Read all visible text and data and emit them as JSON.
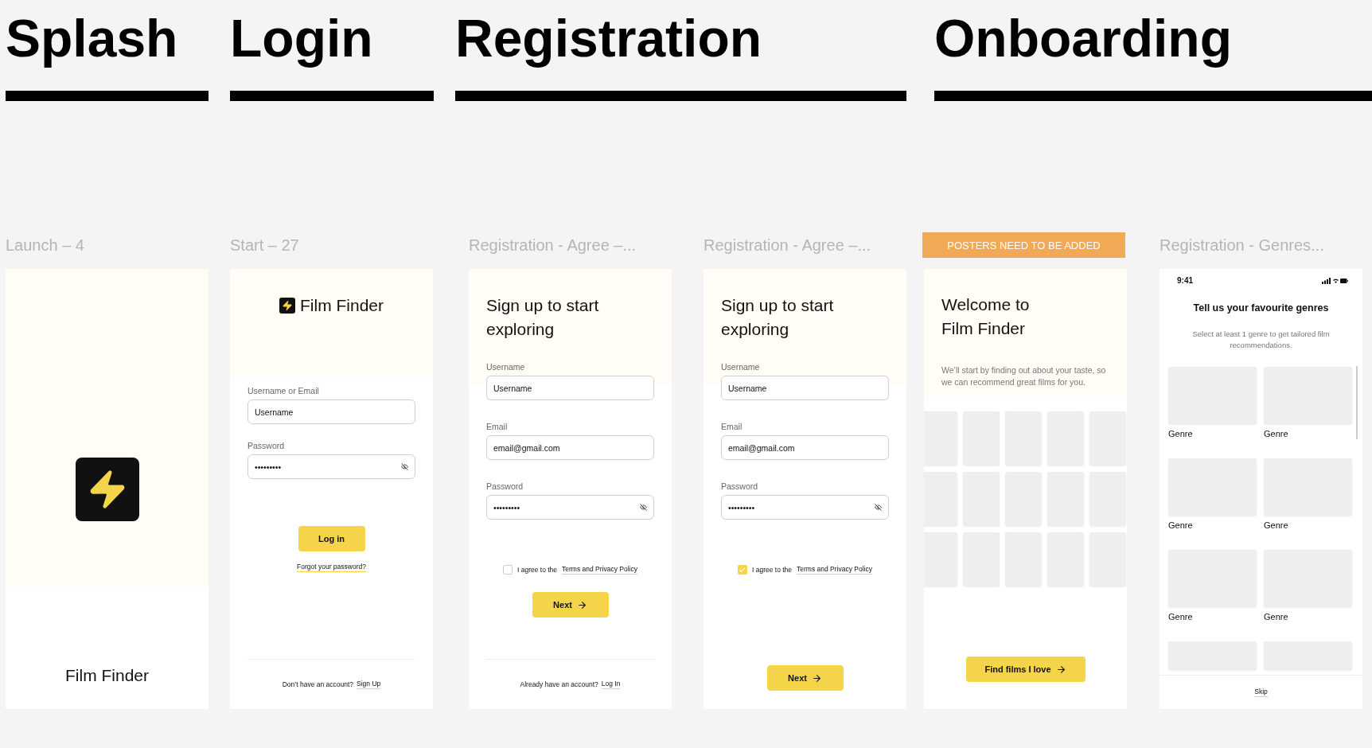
{
  "sections": [
    {
      "title": "Splash"
    },
    {
      "title": "Login"
    },
    {
      "title": "Registration"
    },
    {
      "title": "Onboarding"
    }
  ],
  "frames": [
    {
      "kind": "splash",
      "label": "Launch – 4",
      "app_name": "Film Finder"
    },
    {
      "kind": "login",
      "label": "Start – 27",
      "app_name": "Film Finder",
      "fields": [
        {
          "kind": "text",
          "label": "Username or Email",
          "value": "Username"
        },
        {
          "kind": "password",
          "label": "Password",
          "value": "•••••••••"
        }
      ],
      "button": "Log in",
      "link": "Forgot your password?",
      "footer": {
        "text": "Don’t have an account?",
        "link": "Sign Up"
      }
    },
    {
      "kind": "register",
      "label": "Registration - Agree –...",
      "title": "Sign up to start exploring",
      "fields": [
        {
          "kind": "text",
          "label": "Username",
          "value": "Username"
        },
        {
          "kind": "text",
          "label": "Email",
          "value": "email@gmail.com"
        },
        {
          "kind": "password",
          "label": "Password",
          "value": "•••••••••"
        }
      ],
      "agree": {
        "text": "I agree to the",
        "link": "Terms and Privacy Policy",
        "checked": false
      },
      "button": "Next",
      "footer": {
        "text": "Already have an account?",
        "link": "Log In"
      }
    },
    {
      "kind": "register",
      "label": "Registration - Agree –...",
      "title": "Sign up to start exploring",
      "fields": [
        {
          "kind": "text",
          "label": "Username",
          "value": "Username"
        },
        {
          "kind": "text",
          "label": "Email",
          "value": "email@gmail.com"
        },
        {
          "kind": "password",
          "label": "Password",
          "value": "•••••••••"
        }
      ],
      "agree": {
        "text": "I agree to the",
        "link": "Terms and Privacy Policy",
        "checked": true
      },
      "button": "Next"
    },
    {
      "kind": "welcome",
      "banner": "POSTERS NEED TO BE ADDED",
      "title": "Welcome to Film Finder",
      "description": "We’ll start by finding out about your taste, so we can recommend great films for you.",
      "button": "Find films I love"
    },
    {
      "kind": "genres",
      "label": "Registration - Genres...",
      "time": "9:41",
      "title": "Tell us your favourite genres",
      "subtitle": "Select at least 1 genre to get tailored film recommendations.",
      "genres": [
        {
          "label": "Genre"
        },
        {
          "label": "Genre"
        },
        {
          "label": "Genre"
        },
        {
          "label": "Genre"
        },
        {
          "label": "Genre"
        },
        {
          "label": "Genre"
        }
      ],
      "skip": "Skip"
    }
  ]
}
